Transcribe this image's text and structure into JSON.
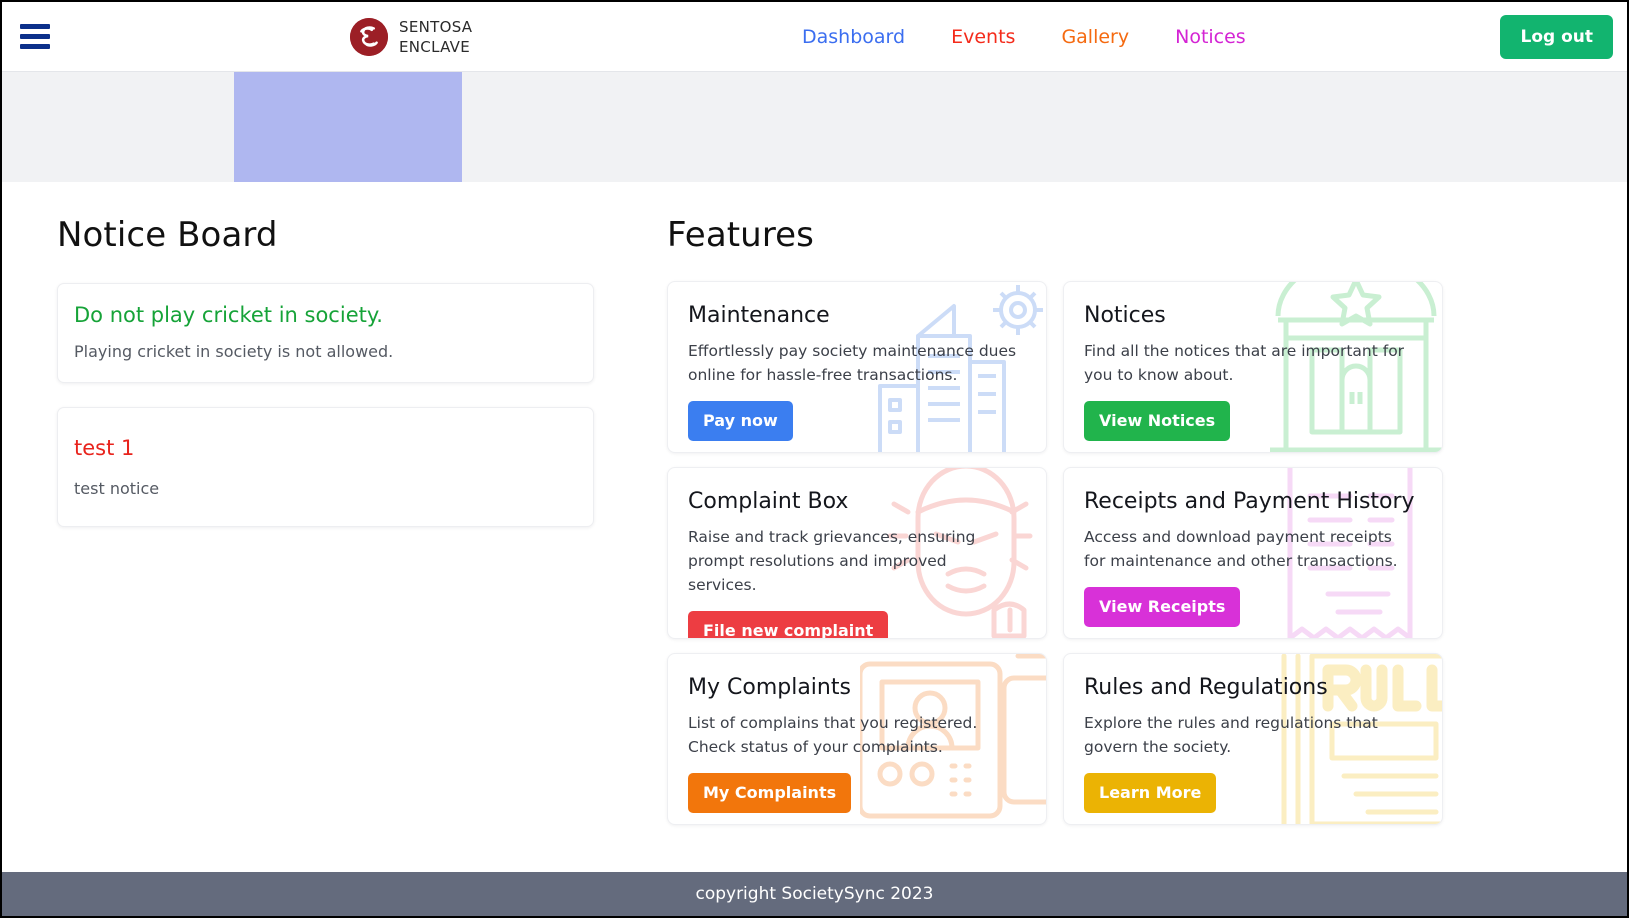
{
  "header": {
    "menu_icon": "hamburger-icon",
    "brand": {
      "logo_icon": "sentosa-s-monogram-icon",
      "name": "SENTOSA\nENCLAVE"
    },
    "nav": [
      {
        "label": "Dashboard",
        "color": "#3b6ef0"
      },
      {
        "label": "Events",
        "color": "#f42b1b"
      },
      {
        "label": "Gallery",
        "color": "#f56a10"
      },
      {
        "label": "Notices",
        "color": "#d424d4"
      }
    ],
    "logout_label": "Log out",
    "logout_color": "#12b46f"
  },
  "banner": {
    "slide_color": "#afb7f0"
  },
  "notice_board": {
    "title": "Notice Board",
    "items": [
      {
        "title": "Do not play cricket in society.",
        "title_color": "#16a338",
        "body": "Playing cricket in society is not allowed."
      },
      {
        "title": "test 1",
        "title_color": "#e8231c",
        "body": "test notice"
      }
    ]
  },
  "features": {
    "title": "Features",
    "cards": [
      {
        "title": "Maintenance",
        "desc": "Effortlessly pay society maintenance dues online for hassle-free transactions.",
        "button": "Pay now",
        "button_color": "#3b7ef0",
        "watermark_icon": "building-gear-icon"
      },
      {
        "title": "Notices",
        "desc": "Find all the notices that are important for you to know about.",
        "button": "View Notices",
        "button_color": "#21b44c",
        "watermark_icon": "courthouse-icon"
      },
      {
        "title": "Complaint Box",
        "desc": "Raise and track grievances, ensuring prompt resolutions and improved services.",
        "button": "File new complaint",
        "button_color": "#ed3d42",
        "watermark_icon": "angry-face-icon"
      },
      {
        "title": "Receipts and Payment History",
        "desc": "Access and download payment receipts for maintenance and other transactions.",
        "button": "View Receipts",
        "button_color": "#d831d8",
        "watermark_icon": "receipt-icon"
      },
      {
        "title": "My Complaints",
        "desc": "List of complains that you registered. Check status of your complaints.",
        "button": "My Complaints",
        "button_color": "#f2760c",
        "watermark_icon": "complaint-list-icon"
      },
      {
        "title": "Rules and Regulations",
        "desc": "Explore the rules and regulations that govern the society.",
        "button": "Learn More",
        "button_color": "#ebb304",
        "watermark_icon": "rules-book-icon"
      }
    ]
  },
  "footer": {
    "text": "copyright SocietySync 2023"
  }
}
